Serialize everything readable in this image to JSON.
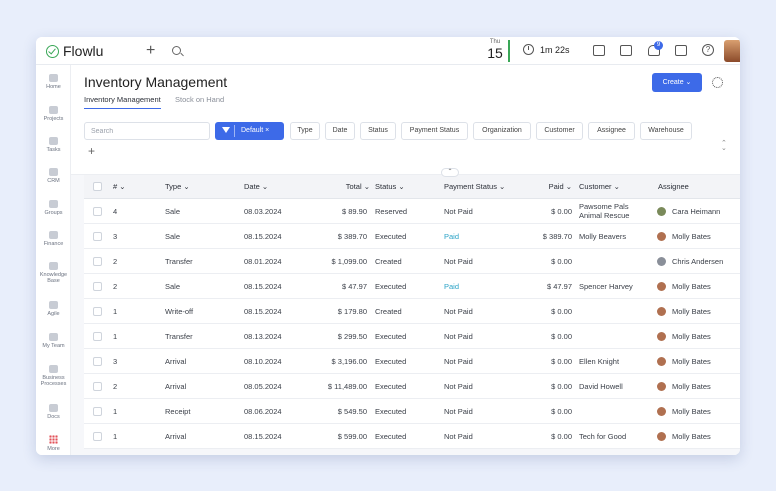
{
  "app": {
    "name": "Flowlu"
  },
  "topbar": {
    "date_dow": "Thu",
    "date_day": "15",
    "timer": "1m 22s",
    "notification_count": "9"
  },
  "sidebar": {
    "items": [
      {
        "label": "Home"
      },
      {
        "label": "Projects"
      },
      {
        "label": "Tasks"
      },
      {
        "label": "CRM"
      },
      {
        "label": "Groups"
      },
      {
        "label": "Finance"
      },
      {
        "label": "Knowledge Base"
      },
      {
        "label": "Agile"
      },
      {
        "label": "My Team"
      },
      {
        "label": "Business Processes"
      },
      {
        "label": "Docs"
      },
      {
        "label": "More"
      }
    ]
  },
  "page": {
    "title": "Inventory Management",
    "tabs": [
      "Inventory Management",
      "Stock on Hand"
    ],
    "create_label": "Create"
  },
  "filters": {
    "search_placeholder": "Search",
    "default_label": "Default ×",
    "chips": [
      "Type",
      "Date",
      "Status",
      "Payment Status",
      "Organization",
      "Customer",
      "Assignee",
      "Warehouse"
    ],
    "add": "+"
  },
  "table": {
    "headers": {
      "num": "# ⌄",
      "type": "Type ⌄",
      "date": "Date ⌄",
      "total": "Total ⌄",
      "status": "Status ⌄",
      "payment_status": "Payment Status ⌄",
      "paid": "Paid ⌄",
      "customer": "Customer ⌄",
      "assignee": "Assignee"
    },
    "rows": [
      {
        "num": "4",
        "type": "Sale",
        "date": "08.03.2024",
        "total": "$ 89.90",
        "status": "Reserved",
        "payment_status": "Not Paid",
        "paid": "$ 0.00",
        "customer": "Pawsome Pals Animal Rescue",
        "assignee": "Cara Heimann"
      },
      {
        "num": "3",
        "type": "Sale",
        "date": "08.15.2024",
        "total": "$ 389.70",
        "status": "Executed",
        "payment_status": "Paid",
        "paid": "$ 389.70",
        "customer": "Molly Beavers",
        "assignee": "Molly Bates"
      },
      {
        "num": "2",
        "type": "Transfer",
        "date": "08.01.2024",
        "total": "$ 1,099.00",
        "status": "Created",
        "payment_status": "Not Paid",
        "paid": "$ 0.00",
        "customer": "",
        "assignee": "Chris Andersen"
      },
      {
        "num": "2",
        "type": "Sale",
        "date": "08.15.2024",
        "total": "$ 47.97",
        "status": "Executed",
        "payment_status": "Paid",
        "paid": "$ 47.97",
        "customer": "Spencer Harvey",
        "assignee": "Molly Bates"
      },
      {
        "num": "1",
        "type": "Write-off",
        "date": "08.15.2024",
        "total": "$ 179.80",
        "status": "Created",
        "payment_status": "Not Paid",
        "paid": "$ 0.00",
        "customer": "",
        "assignee": "Molly Bates"
      },
      {
        "num": "1",
        "type": "Transfer",
        "date": "08.13.2024",
        "total": "$ 299.50",
        "status": "Executed",
        "payment_status": "Not Paid",
        "paid": "$ 0.00",
        "customer": "",
        "assignee": "Molly Bates"
      },
      {
        "num": "3",
        "type": "Arrival",
        "date": "08.10.2024",
        "total": "$ 3,196.00",
        "status": "Executed",
        "payment_status": "Not Paid",
        "paid": "$ 0.00",
        "customer": "Ellen Knight",
        "assignee": "Molly Bates"
      },
      {
        "num": "2",
        "type": "Arrival",
        "date": "08.05.2024",
        "total": "$ 11,489.00",
        "status": "Executed",
        "payment_status": "Not Paid",
        "paid": "$ 0.00",
        "customer": "David Howell",
        "assignee": "Molly Bates"
      },
      {
        "num": "1",
        "type": "Receipt",
        "date": "08.06.2024",
        "total": "$ 549.50",
        "status": "Executed",
        "payment_status": "Not Paid",
        "paid": "$ 0.00",
        "customer": "",
        "assignee": "Molly Bates"
      },
      {
        "num": "1",
        "type": "Arrival",
        "date": "08.15.2024",
        "total": "$ 599.00",
        "status": "Executed",
        "payment_status": "Not Paid",
        "paid": "$ 0.00",
        "customer": "Tech for Good",
        "assignee": "Molly Bates"
      }
    ]
  }
}
